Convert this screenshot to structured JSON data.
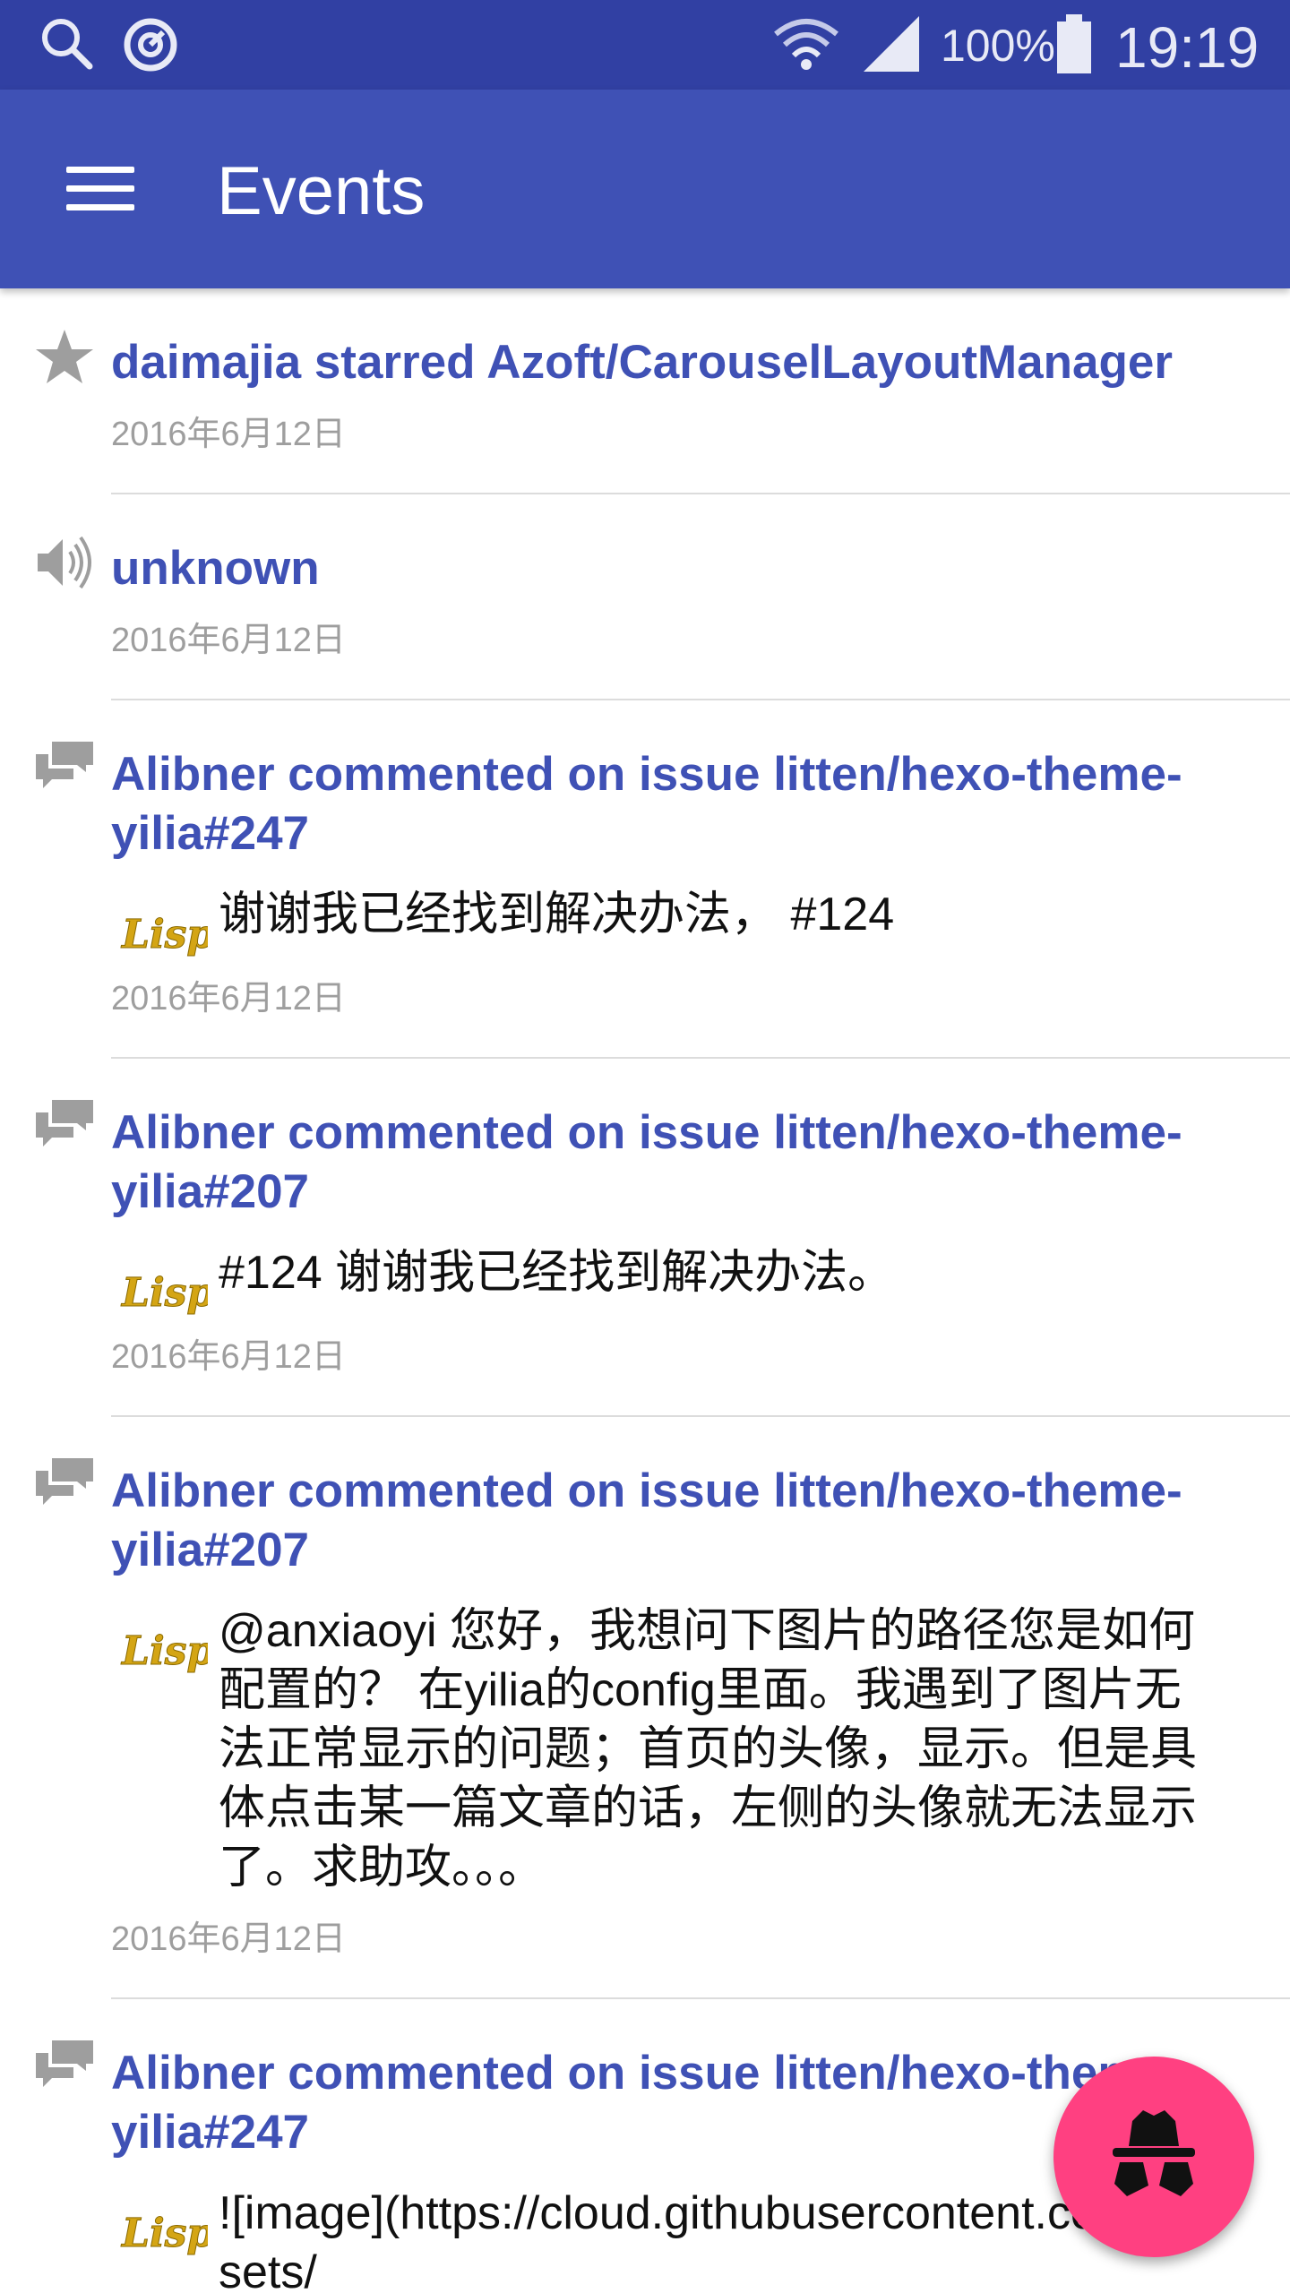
{
  "status_bar": {
    "battery": "100%",
    "time": "19:19",
    "icons": [
      "search-icon",
      "sync-icon",
      "wifi-icon",
      "signal-icon",
      "battery-icon"
    ]
  },
  "app_bar": {
    "title": "Events",
    "menu_icon": "menu-icon"
  },
  "events": [
    {
      "icon": "star-icon",
      "title": "daimajia starred Azoft/CarouselLayoutManager",
      "date": "2016年6月12日"
    },
    {
      "icon": "speaker-icon",
      "title": "unknown",
      "date": "2016年6月12日"
    },
    {
      "icon": "comment-icon",
      "title": "Alibner commented on issue litten/hexo-theme-yilia#247",
      "comment": "谢谢我已经找到解决办法， #124",
      "date": "2016年6月12日"
    },
    {
      "icon": "comment-icon",
      "title": "Alibner commented on issue litten/hexo-theme-yilia#207",
      "comment": "#124 谢谢我已经找到解决办法。",
      "date": "2016年6月12日"
    },
    {
      "icon": "comment-icon",
      "title": "Alibner commented on issue litten/hexo-theme-yilia#207",
      "comment": "@anxiaoyi 您好，我想问下图片的路径您是如何配置的？ 在yilia的config里面。我遇到了图片无法正常显示的问题；首页的头像，显示。但是具体点击某一篇文章的话，左侧的头像就无法显示了。求助攻。。。",
      "date": "2016年6月12日"
    },
    {
      "icon": "comment-icon",
      "title": "Alibner commented on issue litten/hexo-theme-yilia#247",
      "comment": "![image](https://cloud.githubusercontent.com/assets/",
      "date": ""
    }
  ],
  "avatar_text": "Lisp",
  "fab": {
    "icon": "incognito-icon"
  },
  "colors": {
    "status_bar": "#3140a3",
    "app_bar": "#3f51b5",
    "title_text": "#3f51b5",
    "fab": "#ff4081",
    "date_text": "#9e9e9e"
  }
}
